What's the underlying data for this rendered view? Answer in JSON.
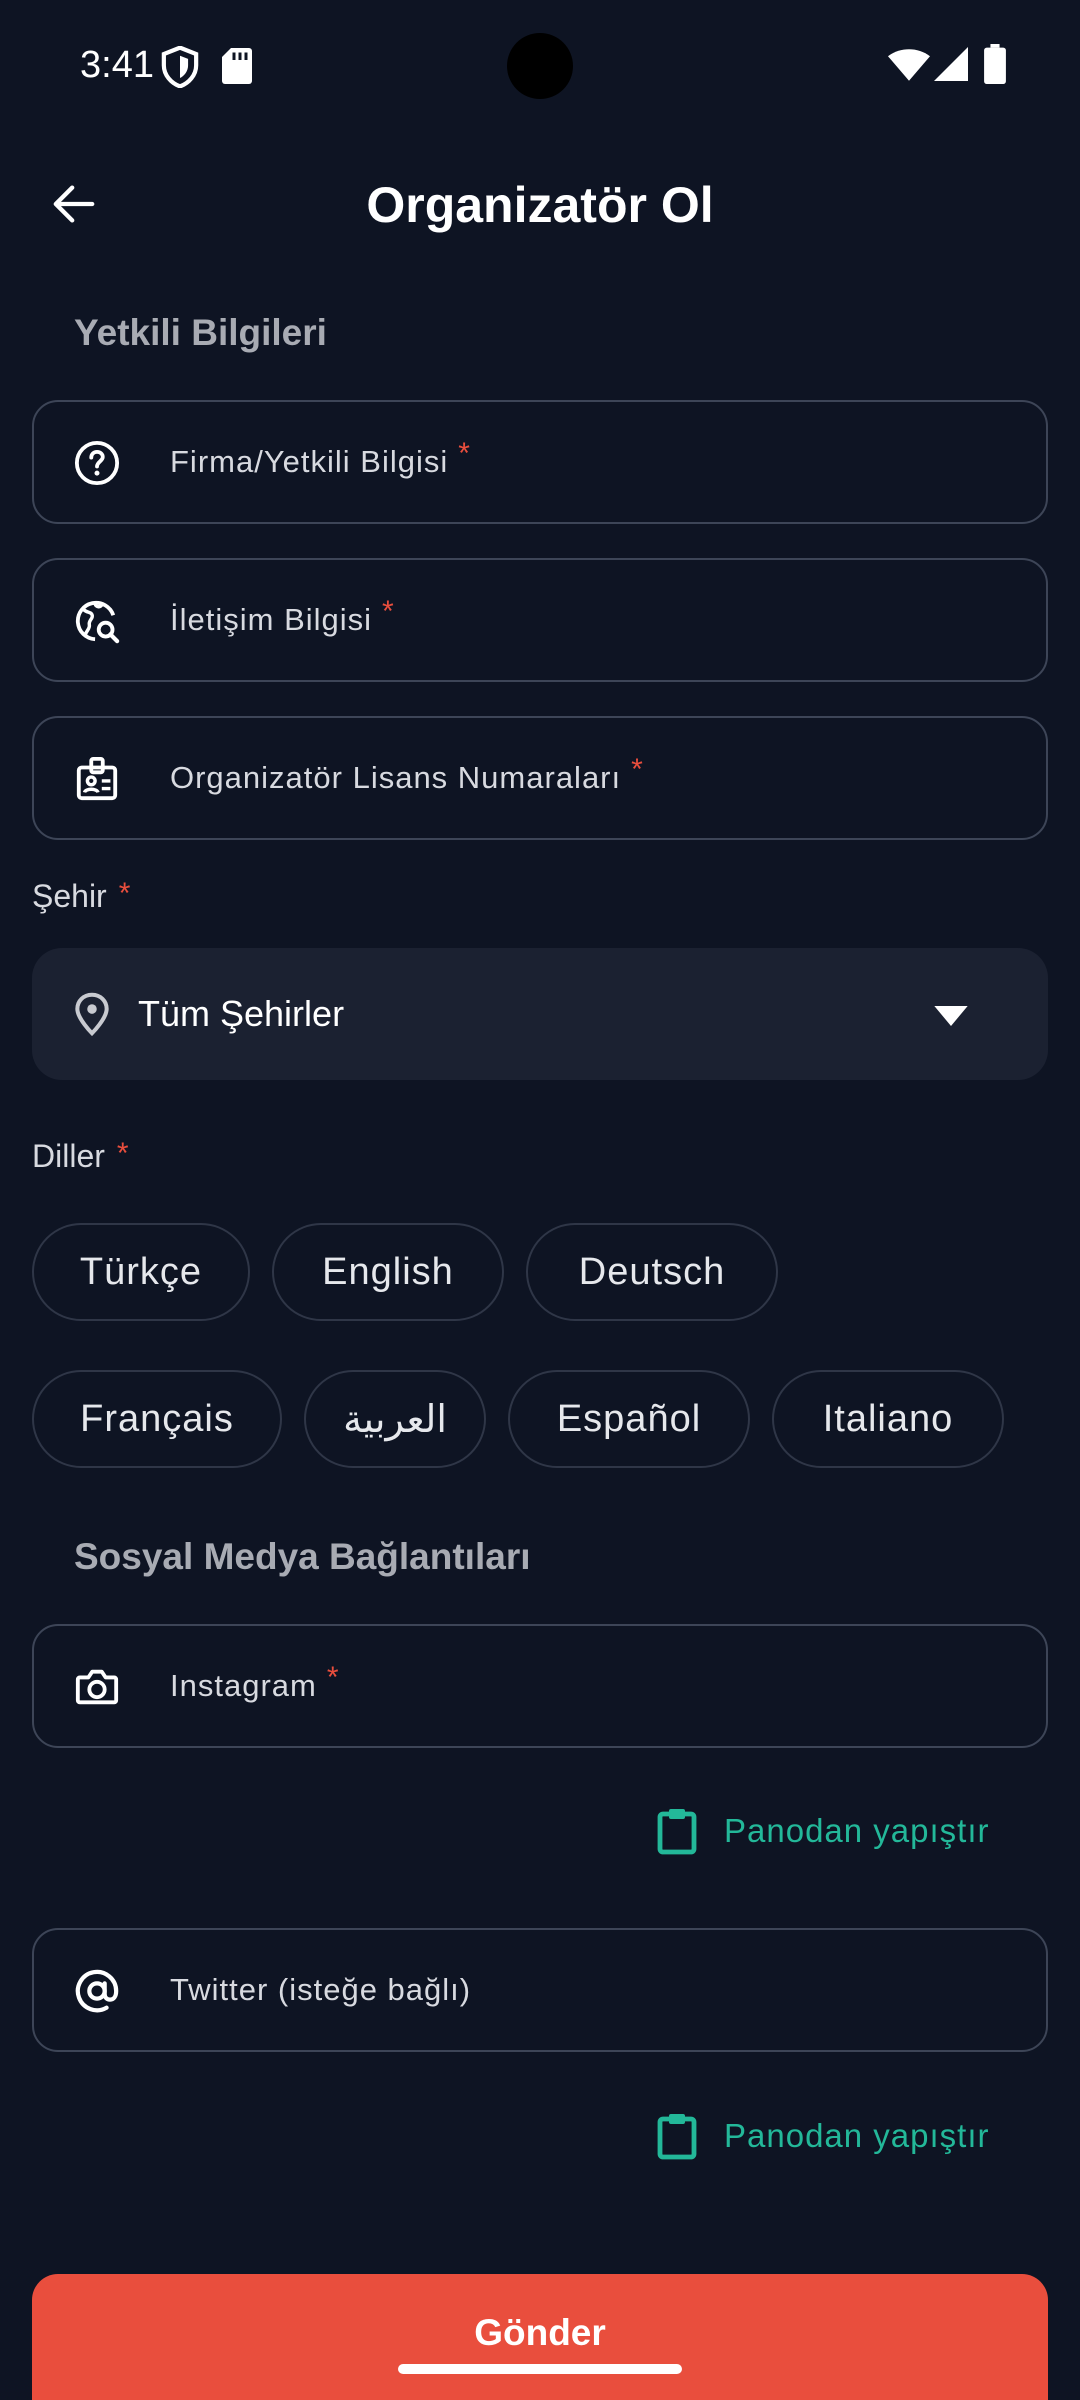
{
  "status_bar": {
    "time": "3:41",
    "icons": [
      "shield-icon",
      "sd-card-icon",
      "wifi-icon",
      "signal-icon",
      "battery-icon"
    ]
  },
  "header": {
    "title": "Organizatör Ol",
    "back_icon": "arrow-left-icon"
  },
  "authorized_section": {
    "heading": "Yetkili Bilgileri",
    "fields": [
      {
        "label": "Firma/Yetkili Bilgisi",
        "required_mark": "*",
        "icon": "help-circle-icon"
      },
      {
        "label": "İletişim Bilgisi",
        "required_mark": "*",
        "icon": "globe-search-icon"
      },
      {
        "label": "Organizatör Lisans Numaraları",
        "required_mark": "*",
        "icon": "badge-icon"
      }
    ]
  },
  "city": {
    "label": "Şehir",
    "required_mark": "*",
    "selected_value": "Tüm Şehirler",
    "icon": "location-pin-icon",
    "caret_icon": "dropdown-caret-icon"
  },
  "languages": {
    "label": "Diller",
    "required_mark": "*",
    "options": [
      "Türkçe",
      "English",
      "Deutsch",
      "Français",
      "العربية",
      "Español",
      "Italiano"
    ]
  },
  "social_section": {
    "heading": "Sosyal Medya Bağlantıları",
    "instagram": {
      "label": "Instagram",
      "required_mark": "*",
      "icon": "camera-icon"
    },
    "twitter": {
      "label": "Twitter (isteğe bağlı)",
      "icon": "at-sign-icon"
    },
    "paste_label": "Panodan yapıştır",
    "paste_icon": "clipboard-icon"
  },
  "submit": {
    "label": "Gönder"
  },
  "colors": {
    "background": "#0e1423",
    "accent_red": "#e94e3d",
    "accent_green": "#23b899",
    "field_border": "#3d4557",
    "dropdown_bg": "#1b2131"
  }
}
